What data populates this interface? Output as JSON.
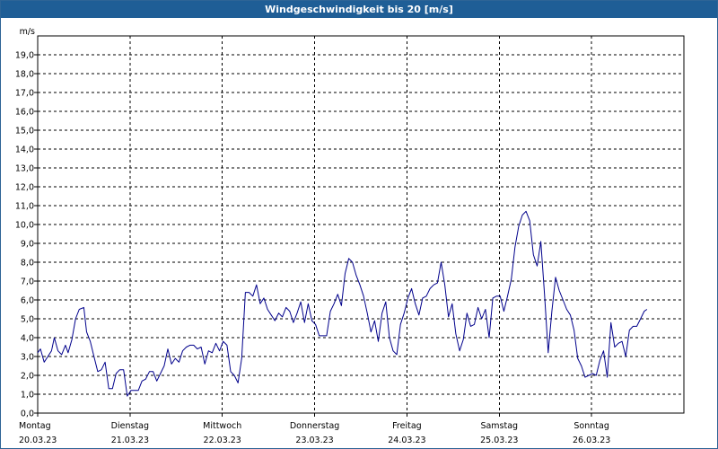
{
  "window": {
    "title": "Windgeschwindigkeit bis 20 [m/s]"
  },
  "chart_data": {
    "type": "line",
    "title": "Windgeschwindigkeit bis 20 [m/s]",
    "ylabel": "m/s",
    "ylim": [
      0,
      20
    ],
    "yticks": [
      "0,0",
      "1,0",
      "2,0",
      "3,0",
      "4,0",
      "5,0",
      "6,0",
      "7,0",
      "8,0",
      "9,0",
      "10,0",
      "11,0",
      "12,0",
      "13,0",
      "14,0",
      "15,0",
      "16,0",
      "17,0",
      "18,0",
      "19,0"
    ],
    "xlim": [
      0,
      7
    ],
    "xlabel_unit": "days from 20.03.23 00:00",
    "xticks": [
      {
        "day": "Montag",
        "date": "20.03.23"
      },
      {
        "day": "Dienstag",
        "date": "21.03.23"
      },
      {
        "day": "Mittwoch",
        "date": "22.03.23"
      },
      {
        "day": "Donnerstag",
        "date": "23.03.23"
      },
      {
        "day": "Freitag",
        "date": "24.03.23"
      },
      {
        "day": "Samstag",
        "date": "25.03.23"
      },
      {
        "day": "Sonntag",
        "date": "26.03.23"
      }
    ],
    "grid": true,
    "series_color": "#00008b",
    "series": [
      {
        "name": "Windgeschwindigkeit",
        "points": [
          [
            0.0,
            3.2
          ],
          [
            0.03,
            3.4
          ],
          [
            0.07,
            2.7
          ],
          [
            0.11,
            3.0
          ],
          [
            0.15,
            3.3
          ],
          [
            0.18,
            4.0
          ],
          [
            0.22,
            3.3
          ],
          [
            0.26,
            3.1
          ],
          [
            0.3,
            3.6
          ],
          [
            0.33,
            3.2
          ],
          [
            0.37,
            3.9
          ],
          [
            0.41,
            5.0
          ],
          [
            0.45,
            5.5
          ],
          [
            0.5,
            5.6
          ],
          [
            0.53,
            4.3
          ],
          [
            0.57,
            3.8
          ],
          [
            0.61,
            3.0
          ],
          [
            0.65,
            2.2
          ],
          [
            0.69,
            2.3
          ],
          [
            0.73,
            2.7
          ],
          [
            0.77,
            1.3
          ],
          [
            0.81,
            1.3
          ],
          [
            0.85,
            2.1
          ],
          [
            0.89,
            2.3
          ],
          [
            0.93,
            2.3
          ],
          [
            0.97,
            0.9
          ],
          [
            1.01,
            1.2
          ],
          [
            1.05,
            1.2
          ],
          [
            1.09,
            1.2
          ],
          [
            1.13,
            1.7
          ],
          [
            1.17,
            1.8
          ],
          [
            1.21,
            2.2
          ],
          [
            1.25,
            2.2
          ],
          [
            1.29,
            1.7
          ],
          [
            1.33,
            2.1
          ],
          [
            1.37,
            2.5
          ],
          [
            1.41,
            3.4
          ],
          [
            1.45,
            2.6
          ],
          [
            1.49,
            2.9
          ],
          [
            1.53,
            2.7
          ],
          [
            1.57,
            3.3
          ],
          [
            1.61,
            3.5
          ],
          [
            1.65,
            3.6
          ],
          [
            1.69,
            3.6
          ],
          [
            1.73,
            3.4
          ],
          [
            1.77,
            3.5
          ],
          [
            1.81,
            2.6
          ],
          [
            1.85,
            3.3
          ],
          [
            1.89,
            3.2
          ],
          [
            1.93,
            3.7
          ],
          [
            1.97,
            3.3
          ],
          [
            2.01,
            3.8
          ],
          [
            2.05,
            3.6
          ],
          [
            2.09,
            2.2
          ],
          [
            2.13,
            2.0
          ],
          [
            2.17,
            1.6
          ],
          [
            2.21,
            2.9
          ],
          [
            2.25,
            6.4
          ],
          [
            2.29,
            6.4
          ],
          [
            2.33,
            6.2
          ],
          [
            2.37,
            6.8
          ],
          [
            2.41,
            5.8
          ],
          [
            2.45,
            6.1
          ],
          [
            2.49,
            5.5
          ],
          [
            2.53,
            5.2
          ],
          [
            2.57,
            4.9
          ],
          [
            2.61,
            5.3
          ],
          [
            2.65,
            5.1
          ],
          [
            2.69,
            5.6
          ],
          [
            2.73,
            5.4
          ],
          [
            2.77,
            4.8
          ],
          [
            2.81,
            5.3
          ],
          [
            2.85,
            5.9
          ],
          [
            2.89,
            4.8
          ],
          [
            2.93,
            5.8
          ],
          [
            2.97,
            4.9
          ],
          [
            3.01,
            4.7
          ],
          [
            3.05,
            4.1
          ],
          [
            3.09,
            4.1
          ],
          [
            3.13,
            4.1
          ],
          [
            3.17,
            5.4
          ],
          [
            3.21,
            5.8
          ],
          [
            3.25,
            6.3
          ],
          [
            3.29,
            5.7
          ],
          [
            3.33,
            7.4
          ],
          [
            3.37,
            8.2
          ],
          [
            3.41,
            8.0
          ],
          [
            3.45,
            7.3
          ],
          [
            3.49,
            6.8
          ],
          [
            3.53,
            6.2
          ],
          [
            3.57,
            5.3
          ],
          [
            3.61,
            4.3
          ],
          [
            3.65,
            4.9
          ],
          [
            3.69,
            3.8
          ],
          [
            3.73,
            5.3
          ],
          [
            3.77,
            5.9
          ],
          [
            3.81,
            4.0
          ],
          [
            3.85,
            3.3
          ],
          [
            3.89,
            3.1
          ],
          [
            3.93,
            4.7
          ],
          [
            3.97,
            5.3
          ],
          [
            4.01,
            6.1
          ],
          [
            4.05,
            6.6
          ],
          [
            4.09,
            5.8
          ],
          [
            4.13,
            5.2
          ],
          [
            4.17,
            6.1
          ],
          [
            4.21,
            6.2
          ],
          [
            4.25,
            6.6
          ],
          [
            4.29,
            6.8
          ],
          [
            4.33,
            6.9
          ],
          [
            4.37,
            8.0
          ],
          [
            4.41,
            6.8
          ],
          [
            4.45,
            5.1
          ],
          [
            4.49,
            5.8
          ],
          [
            4.53,
            4.2
          ],
          [
            4.57,
            3.3
          ],
          [
            4.61,
            3.9
          ],
          [
            4.65,
            5.3
          ],
          [
            4.69,
            4.6
          ],
          [
            4.73,
            4.7
          ],
          [
            4.77,
            5.6
          ],
          [
            4.81,
            5.0
          ],
          [
            4.85,
            5.5
          ],
          [
            4.89,
            4.0
          ],
          [
            4.93,
            6.1
          ],
          [
            4.97,
            6.2
          ],
          [
            5.01,
            6.2
          ],
          [
            5.05,
            5.4
          ],
          [
            5.09,
            6.2
          ],
          [
            5.13,
            7.1
          ],
          [
            5.17,
            8.8
          ],
          [
            5.21,
            9.9
          ],
          [
            5.25,
            10.5
          ],
          [
            5.29,
            10.7
          ],
          [
            5.33,
            10.2
          ],
          [
            5.37,
            8.4
          ],
          [
            5.41,
            7.8
          ],
          [
            5.45,
            9.1
          ],
          [
            5.49,
            6.3
          ],
          [
            5.53,
            3.2
          ],
          [
            5.57,
            5.4
          ],
          [
            5.61,
            7.2
          ],
          [
            5.65,
            6.5
          ],
          [
            5.69,
            6.0
          ],
          [
            5.73,
            5.5
          ],
          [
            5.77,
            5.2
          ],
          [
            5.81,
            4.4
          ],
          [
            5.85,
            2.9
          ],
          [
            5.89,
            2.5
          ],
          [
            5.93,
            1.9
          ],
          [
            5.97,
            2.0
          ],
          [
            6.01,
            2.1
          ],
          [
            6.05,
            2.0
          ],
          [
            6.09,
            2.8
          ],
          [
            6.13,
            3.3
          ],
          [
            6.17,
            1.9
          ],
          [
            6.21,
            4.8
          ],
          [
            6.25,
            3.5
          ],
          [
            6.29,
            3.7
          ],
          [
            6.33,
            3.8
          ],
          [
            6.37,
            3.0
          ],
          [
            6.41,
            4.4
          ],
          [
            6.45,
            4.6
          ],
          [
            6.49,
            4.6
          ],
          [
            6.53,
            5.0
          ],
          [
            6.57,
            5.4
          ],
          [
            6.6,
            5.5
          ]
        ]
      }
    ]
  }
}
